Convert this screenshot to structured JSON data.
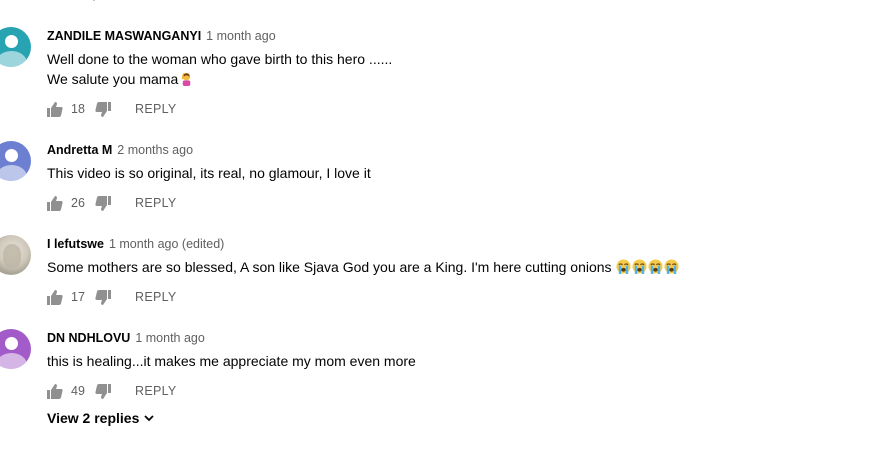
{
  "comments": [
    {
      "author": "ZANDILE MASWANGANYI",
      "time": "1 month ago",
      "lines": [
        "Well done to the woman who gave birth to this hero ......",
        "We salute you mama"
      ],
      "emoji": "raising-hand-emoji",
      "likes": "18",
      "reply_label": "REPLY",
      "avatar_color": "#27a3b2"
    },
    {
      "author": "Andretta M",
      "time": "2 months ago",
      "lines": [
        "This  video is so original, its real, no glamour, I love it"
      ],
      "likes": "26",
      "reply_label": "REPLY",
      "avatar_color": "#6c7fd0"
    },
    {
      "author": "I lefutswe",
      "time": "1 month ago (edited)",
      "lines": [
        "Some mothers are so blessed, A son like Sjava God you are a King. I'm here cutting onions"
      ],
      "emoji": "loudly-crying-face-emoji x4",
      "likes": "17",
      "reply_label": "REPLY",
      "avatar_color": "#cfc8bb"
    },
    {
      "author": "DN NDHLOVU",
      "time": "1 month ago",
      "lines": [
        "this is healing...it makes me appreciate my mom even more"
      ],
      "likes": "49",
      "reply_label": "REPLY",
      "avatar_color": "#a25bc8"
    }
  ],
  "view_replies_label": "View 2 replies",
  "colors": {
    "author_text": "#030303",
    "muted_text": "#606060",
    "icon": "#909090"
  }
}
